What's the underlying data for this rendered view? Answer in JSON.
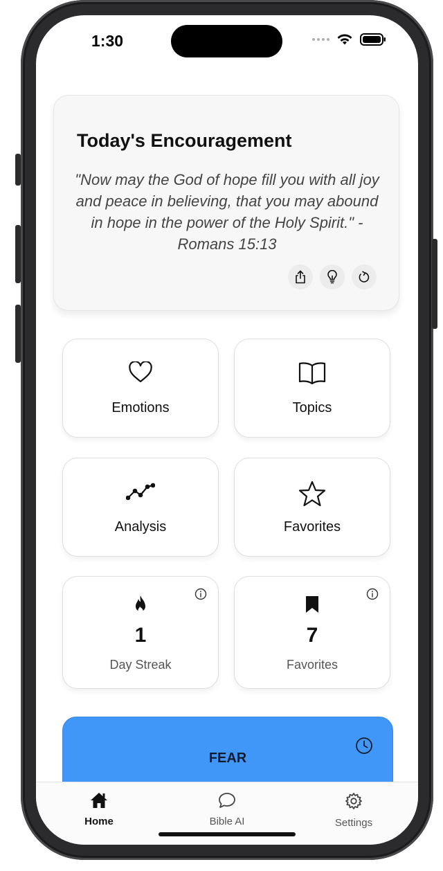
{
  "status": {
    "time": "1:30"
  },
  "encouragement": {
    "title": "Today's Encouragement",
    "quote": "\"Now may the God of hope fill you with all joy and peace in believing, that you may abound in hope in the power of the Holy Spirit.\" - Romans 15:13"
  },
  "tiles": [
    {
      "label": "Emotions",
      "icon": "heart-icon"
    },
    {
      "label": "Topics",
      "icon": "book-icon"
    },
    {
      "label": "Analysis",
      "icon": "trend-line-icon"
    },
    {
      "label": "Favorites",
      "icon": "star-icon"
    }
  ],
  "stats": [
    {
      "value": "1",
      "label": "Day Streak",
      "icon": "flame-icon"
    },
    {
      "value": "7",
      "label": "Favorites",
      "icon": "bookmark-icon"
    }
  ],
  "emotion_card": {
    "label": "FEAR",
    "color": "#4097f7"
  },
  "tabbar": {
    "items": [
      {
        "label": "Home",
        "active": true
      },
      {
        "label": "Bible AI",
        "active": false
      },
      {
        "label": "Settings",
        "active": false
      }
    ]
  }
}
